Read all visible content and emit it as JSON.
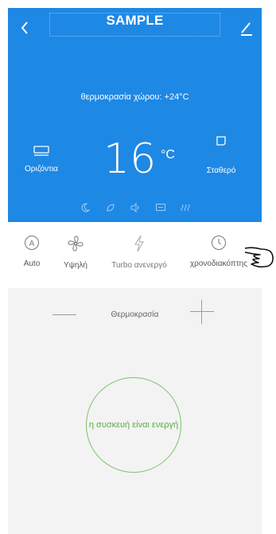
{
  "header": {
    "title": "SAMPLE",
    "back_icon": "chevron-left-icon",
    "edit_icon": "edit-pencil-icon",
    "room_temperature": "θερμοκρασία χώρου: +24°C"
  },
  "display": {
    "swing_label": "Οριζόντια",
    "swing_icon": "horizontal-swing-icon",
    "setpoint_value": "16",
    "setpoint_unit": "°C",
    "mode_label": "Σταθερό",
    "mode_icon": "fixed-mode-icon",
    "status_icons": [
      "moon-icon",
      "eco-leaf-icon",
      "speaker-icon",
      "display-icon",
      "heat-icon"
    ]
  },
  "controls": [
    {
      "label": "Auto",
      "icon": "auto-mode-icon"
    },
    {
      "label": "Υψηλή",
      "icon": "fan-icon"
    },
    {
      "label": "Turbo ανενεργό",
      "icon": "turbo-icon"
    },
    {
      "label": "χρονοδιακόπτης",
      "icon": "clock-icon"
    }
  ],
  "temperature_control": {
    "label": "Θερμοκρασία"
  },
  "power": {
    "status_text": "η συσκευή είναι ενεργή"
  },
  "colors": {
    "header_blue": "#1e88e5",
    "status_green": "#5aad47",
    "panel_gray": "#f3f3f3"
  }
}
